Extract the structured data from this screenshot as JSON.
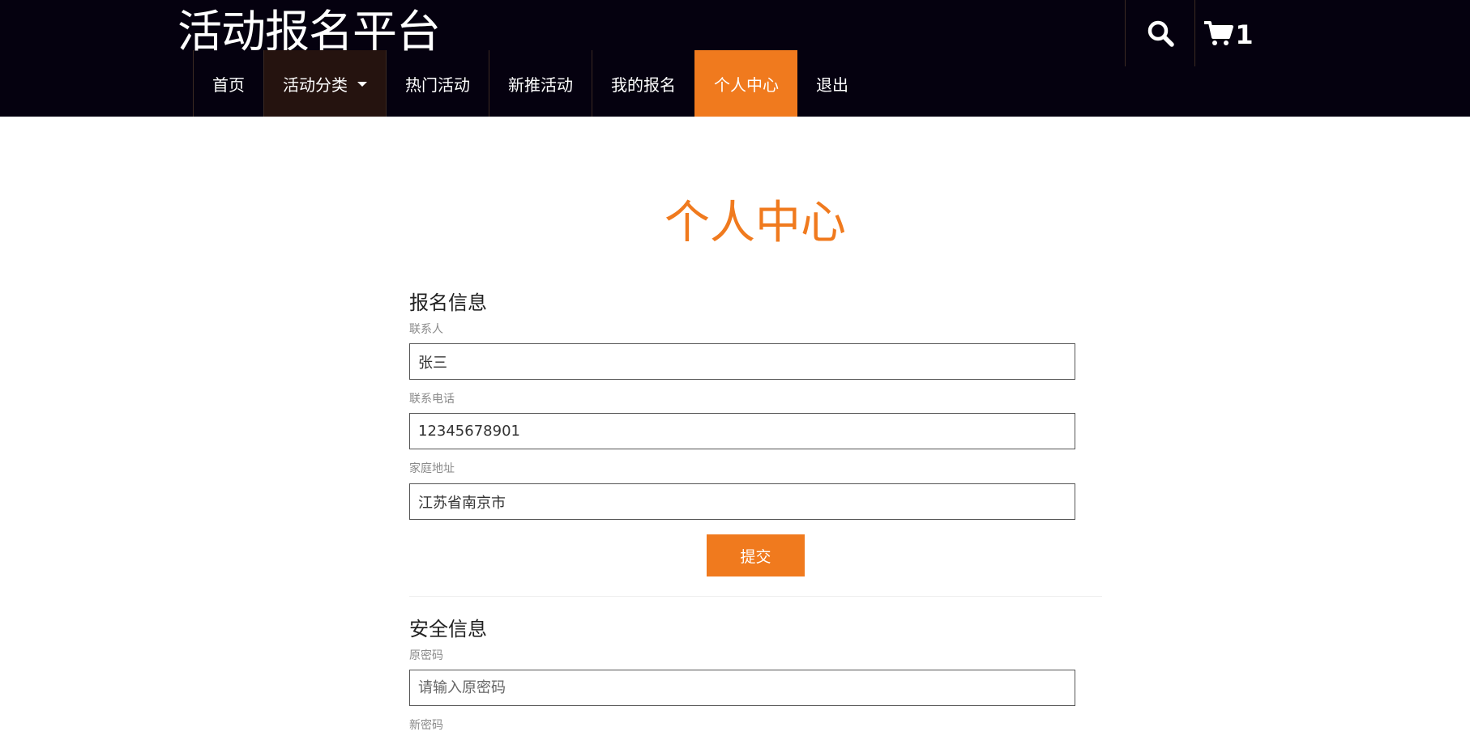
{
  "header": {
    "brand": "活动报名平台",
    "nav": [
      {
        "label": "首页"
      },
      {
        "label": "活动分类"
      },
      {
        "label": "热门活动"
      },
      {
        "label": "新推活动"
      },
      {
        "label": "我的报名"
      },
      {
        "label": "个人中心"
      },
      {
        "label": "退出"
      }
    ],
    "search_icon": "search-icon",
    "cart_icon": "cart-icon",
    "cart_count": "1",
    "accent_color": "#f07a1e"
  },
  "main": {
    "title": "个人中心",
    "registration": {
      "title": "报名信息",
      "contact_label": "联系人",
      "contact_value": "张三",
      "phone_label": "联系电话",
      "phone_value": "12345678901",
      "address_label": "家庭地址",
      "address_value": "江苏省南京市",
      "submit_label": "提交"
    },
    "security": {
      "title": "安全信息",
      "old_password_label": "原密码",
      "old_password_placeholder": "请输入原密码",
      "new_password_label": "新密码"
    }
  }
}
